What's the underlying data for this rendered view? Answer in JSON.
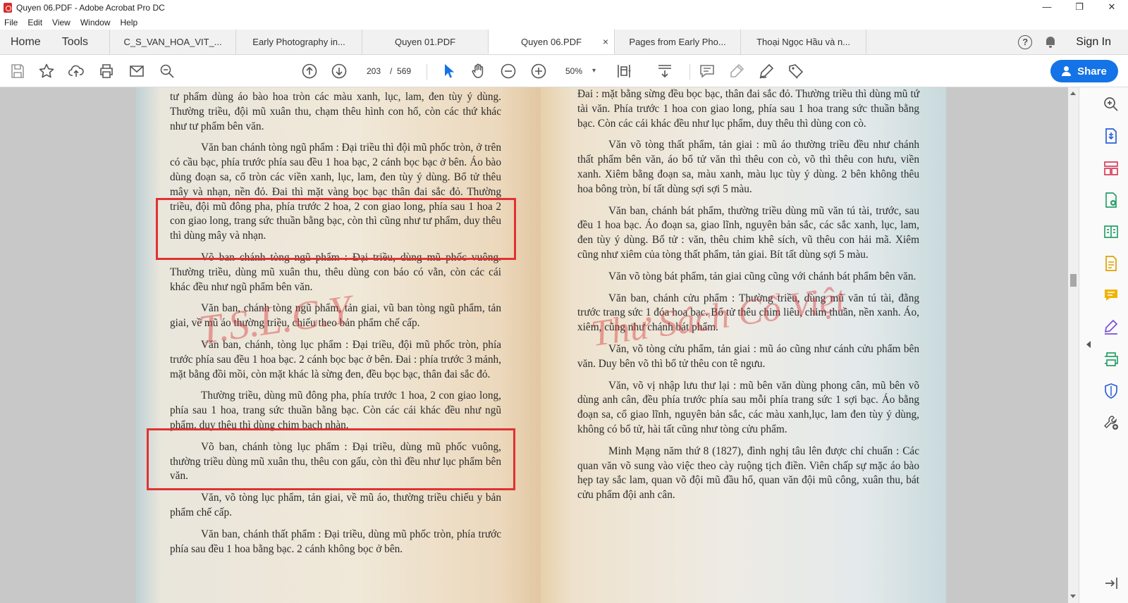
{
  "window": {
    "title": "Quyen 06.PDF - Adobe Acrobat Pro DC",
    "controls": [
      "—",
      "❐",
      "✕"
    ]
  },
  "menu": [
    "File",
    "Edit",
    "View",
    "Window",
    "Help"
  ],
  "tabs": {
    "home": "Home",
    "tools": "Tools",
    "documents": [
      {
        "label": "C_S_VAN_HOA_VIT_...",
        "active": false
      },
      {
        "label": "Early Photography in...",
        "active": false
      },
      {
        "label": "Quyen 01.PDF",
        "active": false
      },
      {
        "label": "Quyen 06.PDF",
        "active": true
      },
      {
        "label": "Pages from Early Pho...",
        "active": false
      },
      {
        "label": "Thoại Ngọc Hầu và n...",
        "active": false
      }
    ],
    "close_glyph": "×",
    "help_glyph": "?",
    "sign_in": "Sign In"
  },
  "toolbar": {
    "current_page": "203",
    "separator": "/",
    "total_pages": "569",
    "zoom": "50%",
    "zoom_caret": "▾",
    "share": "Share",
    "accent": "#1473e6"
  },
  "document": {
    "left_page": [
      "tư phẩm dùng áo bào hoa tròn các màu xanh, lục, lam, đen tùy ý dùng. Thường triều, đội mũ xuân thu, chạm thêu hình con hổ, còn các thứ khác như tư phẩm bên văn.",
      "Văn ban chánh tòng ngũ phẩm : Đại triều thì đội mũ phốc tròn, ở trên có cầu bạc, phía trước phía sau đều 1 hoa bạc, 2 cánh bọc bạc ở bên. Áo bào dùng đoạn sa, cổ tròn các viền xanh, lục, lam, đen tùy ý dùng. Bổ tử thêu mây và nhạn, nền đỏ. Đai thì mặt vàng bọc bạc thân đai sắc đỏ. Thường triều, đội mũ đông pha, phía trước 2 hoa, 2 con giao long, phía sau 1 hoa 2 con giao long, trang sức thuần bằng bạc, còn thì cũng như tư phẩm, duy thêu thì dùng mây và nhạn.",
      "Võ ban chánh tòng ngũ phẩm : Đại triều, dùng mũ phốc vuông. Thường triều, dùng mũ xuân thu, thêu dùng con báo có vằn, còn các cái khác đều như ngũ phẩm bên văn.",
      "Văn ban, chánh tòng ngũ phẩm, tản giai, vũ ban tòng ngũ phẩm, tản giai, về mũ áo thường triều, chiếu theo bản phẩm chế cấp.",
      "Văn ban, chánh, tòng lục phẩm : Đại triều, đội mũ phốc tròn, phía trước phía sau đều 1 hoa bạc. 2 cánh bọc bạc ở bên. Đai : phía trước 3 mảnh, mặt bằng đồi mồi, còn mặt khác là sừng đen, đều bọc bạc, thân đai sắc đỏ.",
      "Thường triều, dùng mũ đông pha, phía trước 1 hoa, 2 con giao long, phía sau 1 hoa, trang sức thuần bằng bạc. Còn các cái khác đều như ngũ phẩm. duy thêu thì dùng chim bạch nhàn.",
      "Võ ban, chánh tòng lục phẩm : Đại triều, dùng mũ phốc vuông, thường triều dùng mũ xuân thu, thêu con gấu, còn thì đều như lục phẩm bên văn.",
      "Văn, võ tòng lục phẩm, tản giai, về mũ áo, thường triều chiếu y bản phẩm chế cấp.",
      "Văn ban, chánh thất phẩm : Đại triều, dùng mũ phốc tròn, phía trước phía sau đều 1 hoa bằng bạc. 2 cánh không bọc ở bên."
    ],
    "right_page": [
      "Đai : mặt bằng sừng đều bọc bạc, thân đai sắc đỏ. Thường triều thì dùng mũ tứ tài văn. Phía trước 1 hoa con giao long, phía sau 1 hoa trang sức thuần bằng bạc. Còn các cái khác đều như lục phẩm, duy thêu thì dùng con cò.",
      "Văn võ tòng thất phẩm, tản giai : mũ áo thường triều đều như chánh thất phẩm bên văn, áo bổ tử văn thì thêu con cò, võ thì thêu con hưu, viền xanh. Xiêm bằng đoạn sa, màu xanh, màu lục tùy ý dùng. 2 bên không thêu hoa bông tròn, bí tất dùng sợi sợi 5 màu.",
      "Văn ban, chánh bát phẩm, thường triều dùng mũ văn tú tài, trước, sau đều 1 hoa bạc. Áo đoạn sa, giao lĩnh, nguyên bản sắc, các sắc xanh, lục, lam, đen tùy ý dùng. Bổ tử : văn, thêu chim khê sích, vũ thêu con hải mã. Xiêm cũng như xiêm của tòng thất phẩm, tản giai. Bít tất dùng sợi 5 màu.",
      "Văn võ tòng bát phẩm, tản giai cũng cũng với chánh bát phẩm bên văn.",
      "Văn ban, chánh cửu phẩm : Thường triều, dùng mũ văn tú tài, đằng trước trang sức 1 đóa hoa bạc. Bổ tử thêu chim liêu, chim thuần, nền xanh. Áo, xiêm, cũng như chánh bát phẩm.",
      "Văn, võ tòng cửu phẩm, tản giai : mũ áo cũng như cánh cửu phẩm bên văn. Duy bên võ thì bổ tử thêu con tê ngưu.",
      "Văn, võ vị nhập lưu thư lại : mũ bên văn dùng phong cân, mũ bên võ dùng anh cân, đều phía trước phía sau mỗi phía trang sức 1 sợi bạc. Áo bằng đoạn sa, cổ giao lĩnh, nguyên bản sắc, các màu xanh,lục, lam đen tùy ý dùng, không có bổ tử, hài tất cũng như tòng cửu phẩm.",
      "Minh Mạng năm thứ 8 (1827), đình nghị tâu lên được chỉ chuẩn : Các quan văn võ sung vào việc theo cày ruộng tịch điền. Viên chấp sự mặc áo bào hẹp tay sắc lam, quan võ đội mũ đầu hổ, quan văn đội mũ công, xuân thu, bát cửu phẩm đội anh cân."
    ],
    "watermark_left": "T.S.L.C.Y",
    "watermark_right": "Thư Sách Cổ Việt",
    "highlight_color": "#e03232"
  }
}
